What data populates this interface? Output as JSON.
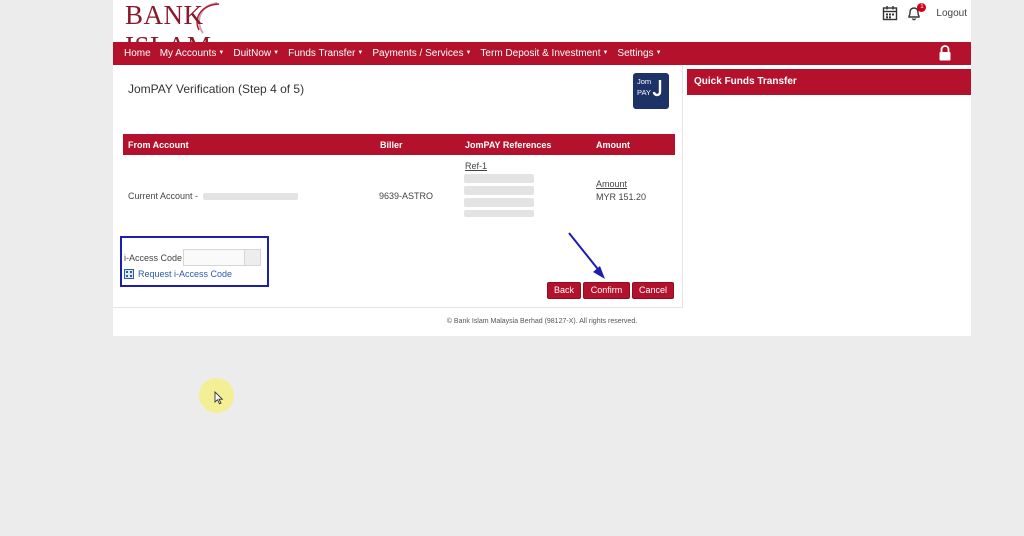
{
  "brand": {
    "name": "BANK ISLAM"
  },
  "header": {
    "logout_label": "Logout",
    "notification_count": "1"
  },
  "nav": {
    "items": [
      {
        "label": "Home",
        "dropdown": false
      },
      {
        "label": "My Accounts",
        "dropdown": true
      },
      {
        "label": "DuitNow",
        "dropdown": true
      },
      {
        "label": "Funds Transfer",
        "dropdown": true
      },
      {
        "label": "Payments / Services",
        "dropdown": true
      },
      {
        "label": "Term Deposit & Investment",
        "dropdown": true
      },
      {
        "label": "Settings",
        "dropdown": true
      }
    ]
  },
  "main": {
    "title": "JomPAY Verification (Step 4 of 5)",
    "logo_top": "Jom",
    "logo_bottom": "PAY",
    "table": {
      "headers": {
        "from_account": "From Account",
        "biller": "Biller",
        "references": "JomPAY References",
        "amount": "Amount"
      },
      "row": {
        "from_account": "Current Account -",
        "biller": "9639-ASTRO",
        "ref_label": "Ref-1",
        "amount_label": "Amount",
        "amount_value": "MYR 151.20"
      }
    },
    "access": {
      "label": "i-Access Code",
      "value": "",
      "request_link": "Request i-Access Code"
    },
    "buttons": {
      "back": "Back",
      "confirm": "Confirm",
      "cancel": "Cancel"
    }
  },
  "side": {
    "title": "Quick Funds Transfer"
  },
  "footer": {
    "text": "© Bank Islam Malaysia Berhad (98127-X). All rights reserved."
  },
  "colors": {
    "brand_red": "#b4122c",
    "annotation_blue": "#1b1fb0",
    "jompay_blue": "#1d3266"
  },
  "icons": [
    "calendar-icon",
    "bell-icon",
    "lock-icon",
    "request-code-icon",
    "mouse-cursor-icon"
  ]
}
